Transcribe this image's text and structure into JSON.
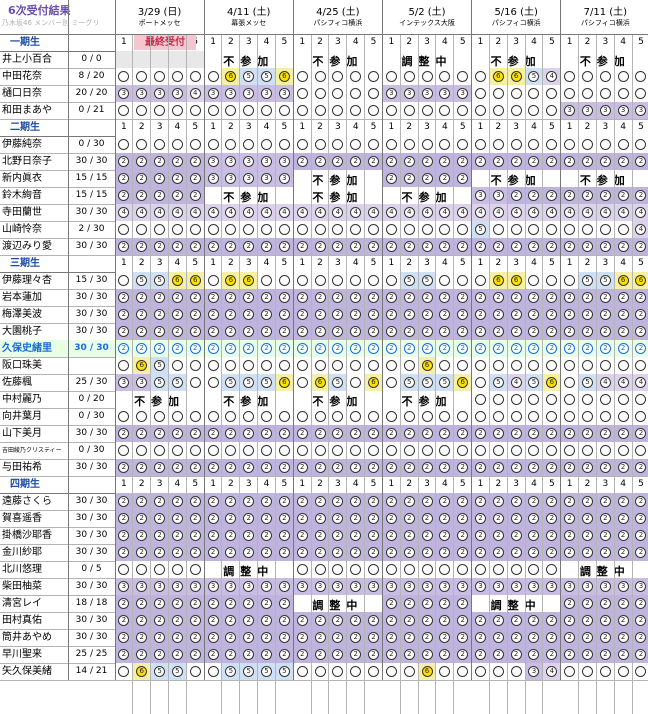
{
  "header": {
    "title": "6次受付結果",
    "subtitle": "乃木坂46 メンバー別 ミーグリ"
  },
  "events": [
    {
      "date": "3/29 (日)",
      "venue": "ポートメッセ"
    },
    {
      "date": "4/11 (土)",
      "venue": "幕張メッセ"
    },
    {
      "date": "4/25 (土)",
      "venue": "パシフィコ横浜"
    },
    {
      "date": "5/2 (土)",
      "venue": "インテックス大阪"
    },
    {
      "date": "5/16 (土)",
      "venue": "パシフィコ横浜"
    },
    {
      "date": "7/11 (土)",
      "venue": "パシフィコ横浜"
    }
  ],
  "last_accept_label": "最終受付",
  "part_numbers": [
    "1",
    "2",
    "3",
    "4",
    "5"
  ],
  "band_labels": {
    "N": "不参加",
    "A": "調整中"
  },
  "colors": {
    "6": "#f6f0a6",
    "5": "#cfe0f4",
    "4": "#dcd2ec",
    "3": "#c9bde3",
    "2": "#bfb4de",
    "0": "#ffffff",
    "N": "#ffffff",
    "A": "#ffffff",
    "H": "#ffffff",
    "E": "#e8e8e8",
    "hlrow": "#e6ffe6"
  },
  "groups": [
    {
      "label": "一期生",
      "members": [
        {
          "name": "井上小百合",
          "count": "0 / 0",
          "cells": "EEEEE NNNNN NNNNN AAAAA NNNNN NNNNN"
        },
        {
          "name": "中田花奈",
          "count": "8 / 20",
          "cells": "00000 06556 00000 00000 06654 00000"
        },
        {
          "name": "樋口日奈",
          "count": "20 / 20",
          "cells": "33334 33333 00000 33333 00000 00000"
        },
        {
          "name": "和田まあや",
          "count": "0 / 21",
          "cells": "00000 00000 00000 00000 00000 33333"
        }
      ]
    },
    {
      "label": "二期生",
      "members": [
        {
          "name": "伊藤純奈",
          "count": "0 / 30",
          "cells": "00000 00000 00000 00000 00000 00000"
        },
        {
          "name": "北野日奈子",
          "count": "30 / 30",
          "cells": "22222 33333 22222 22222 22222 22222"
        },
        {
          "name": "新内眞衣",
          "count": "15 / 15",
          "cells": "22222 33333 NNNNN 22222 NNNNN NNNNN"
        },
        {
          "name": "鈴木絢音",
          "count": "15 / 15",
          "cells": "22222 NNNNN NNNNN NNNNN 33222 22222"
        },
        {
          "name": "寺田蘭世",
          "count": "30 / 30",
          "cells": "44444 44444 44444 44444 44444 44444"
        },
        {
          "name": "山崎怜奈",
          "count": "2 / 30",
          "cells": "00000 00000 00000 00000 50000 00004"
        },
        {
          "name": "渡辺みり愛",
          "count": "30 / 30",
          "cells": "22222 22222 22222 22222 22222 22222"
        }
      ]
    },
    {
      "label": "三期生",
      "members": [
        {
          "name": "伊藤理々杏",
          "count": "15 / 30",
          "cells": "05566 06600 00000 05500 06600 05566"
        },
        {
          "name": "岩本蓮加",
          "count": "30 / 30",
          "cells": "22222 22222 22222 22222 22222 22222"
        },
        {
          "name": "梅澤美波",
          "count": "30 / 30",
          "cells": "22222 22222 22222 22222 22222 22222"
        },
        {
          "name": "大園桃子",
          "count": "30 / 30",
          "cells": "22222 22222 22222 22222 22222 22222"
        },
        {
          "name": "久保史緒里",
          "count": "30 / 30",
          "cells": "HHHHH HHHHH HHHHH HHHHH HHHHH HHHHH",
          "highlight": true
        },
        {
          "name": "阪口珠美",
          "count": "",
          "cells": "06500 00000 00000 00600 00000 00000"
        },
        {
          "name": "佐藤楓",
          "count": "25 / 30",
          "cells": "33550 05556 06506 05556 05456 05444"
        },
        {
          "name": "中村麗乃",
          "count": "0 / 20",
          "cells": "NNNNN NNNNN NNNNN NNNNN 00000 00000"
        },
        {
          "name": "向井葉月",
          "count": "0 / 30",
          "cells": "00000 00000 00000 00000 00000 00000"
        },
        {
          "name": "山下美月",
          "count": "30 / 30",
          "cells": "22222 22222 22222 22222 22222 22222"
        },
        {
          "name": "吉田綾乃クリスティー",
          "count": "0 / 30",
          "cells": "00000 00000 00000 00000 00000 00000",
          "small": true
        },
        {
          "name": "与田祐希",
          "count": "30 / 30",
          "cells": "22222 22222 22222 22222 22222 22222"
        }
      ]
    },
    {
      "label": "四期生",
      "members": [
        {
          "name": "遠藤さくら",
          "count": "30 / 30",
          "cells": "22222 22222 22222 22222 22222 22222"
        },
        {
          "name": "賀喜遥香",
          "count": "30 / 30",
          "cells": "22222 22222 22222 22222 22222 22222"
        },
        {
          "name": "掛橋沙耶香",
          "count": "30 / 30",
          "cells": "22222 22222 22222 22222 22222 22222"
        },
        {
          "name": "金川紗耶",
          "count": "30 / 30",
          "cells": "22222 22222 22222 22222 22222 22222"
        },
        {
          "name": "北川悠理",
          "count": "0 / 5",
          "cells": "00000 AAAAA 00000 00000 00000 AAAAA"
        },
        {
          "name": "柴田柚菜",
          "count": "30 / 30",
          "cells": "33333 33333 33333 33333 33333 33333"
        },
        {
          "name": "清宮レイ",
          "count": "18 / 18",
          "cells": "22222 22222 AAAAA 22222 AAAAA 22222"
        },
        {
          "name": "田村真佑",
          "count": "30 / 30",
          "cells": "22222 22222 22222 22222 22222 22222"
        },
        {
          "name": "筒井あやめ",
          "count": "30 / 30",
          "cells": "22222 22222 22222 22222 22222 22222"
        },
        {
          "name": "早川聖来",
          "count": "25 / 25",
          "cells": "22222 22222 22222 22222 22222 22222"
        },
        {
          "name": "矢久保美緒",
          "count": "14 / 21",
          "cells": "06550 05555 00000 00600 00034 00000"
        }
      ]
    }
  ]
}
